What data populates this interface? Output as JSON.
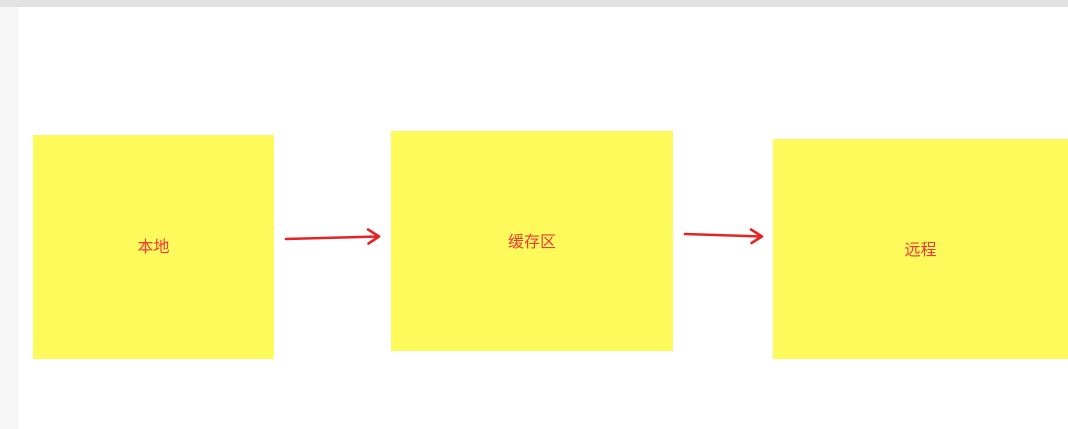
{
  "diagram": {
    "node_color": "#fffa5c",
    "text_color": "#ee3a3a",
    "arrow_color": "#e42424",
    "nodes": [
      {
        "id": "local",
        "label": "本地"
      },
      {
        "id": "cache",
        "label": "缓存区"
      },
      {
        "id": "remote",
        "label": "远程"
      }
    ],
    "edges": [
      {
        "from": "local",
        "to": "cache"
      },
      {
        "from": "cache",
        "to": "remote"
      }
    ]
  }
}
